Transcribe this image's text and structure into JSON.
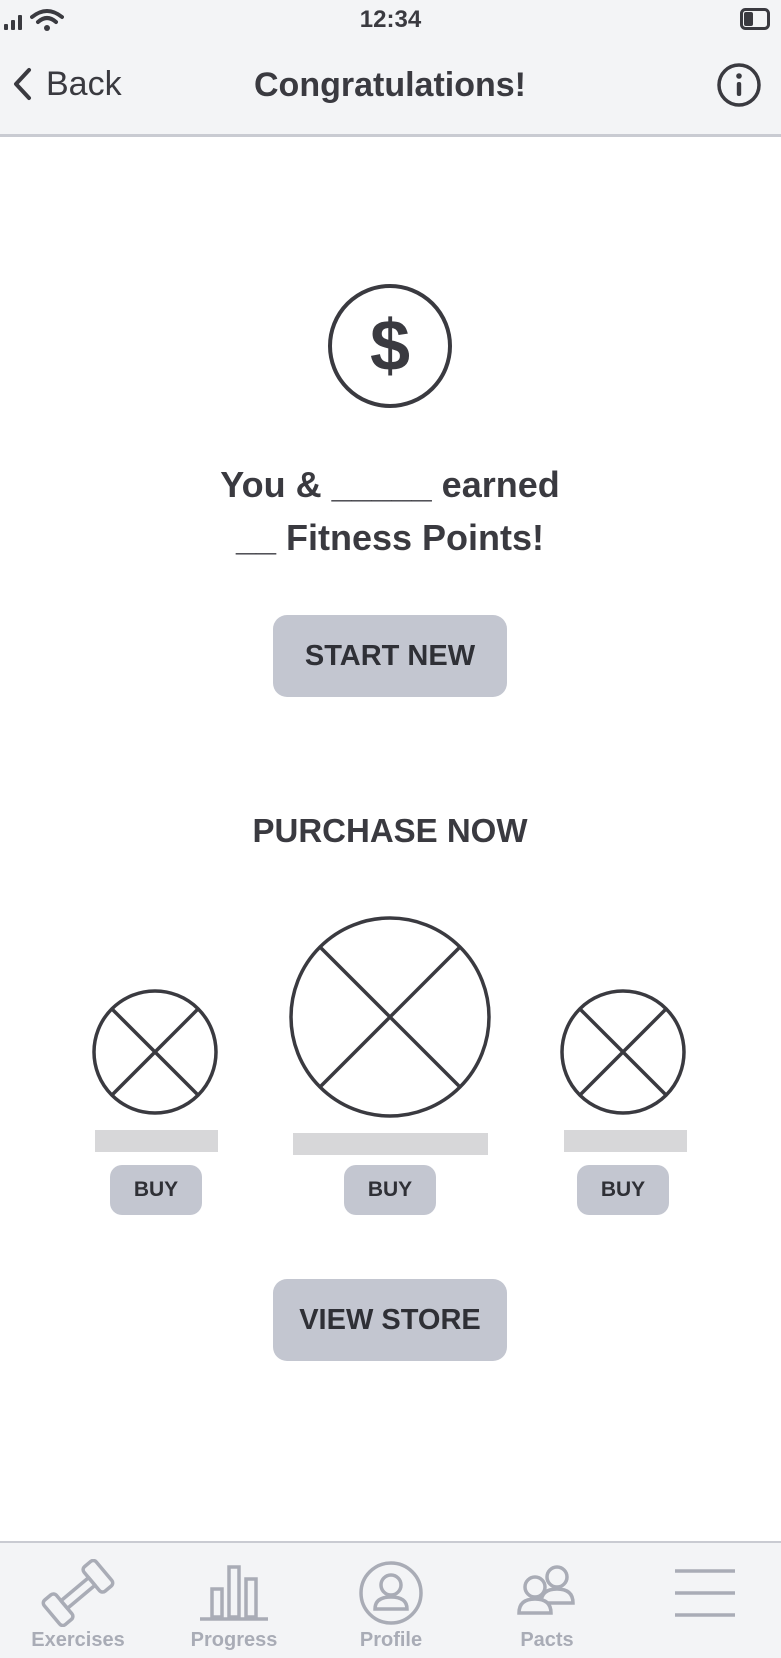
{
  "status_bar": {
    "time": "12:34"
  },
  "nav": {
    "back_label": "Back",
    "title": "Congratulations!"
  },
  "reward": {
    "icon_symbol": "$",
    "line1": "You & _____ earned",
    "line2": "__ Fitness Points!"
  },
  "start_new": {
    "label": "START NEW"
  },
  "purchase": {
    "title": "PURCHASE NOW",
    "items": [
      {
        "buy_label": "BUY"
      },
      {
        "buy_label": "BUY"
      },
      {
        "buy_label": "BUY"
      }
    ]
  },
  "view_store": {
    "label": "VIEW STORE"
  },
  "tabs": [
    {
      "label": "Exercises",
      "icon": "dumbbell-icon"
    },
    {
      "label": "Progress",
      "icon": "bar-chart-icon"
    },
    {
      "label": "Profile",
      "icon": "person-circle-icon"
    },
    {
      "label": "Pacts",
      "icon": "group-icon"
    },
    {
      "label": "",
      "icon": "hamburger-menu-icon"
    }
  ],
  "colors": {
    "bar_background": "#f3f4f6",
    "button": "#c3c6d0",
    "text_dark": "#3a3a40",
    "tab_inactive": "#a9acb6",
    "placeholder": "#d7d7d9"
  }
}
